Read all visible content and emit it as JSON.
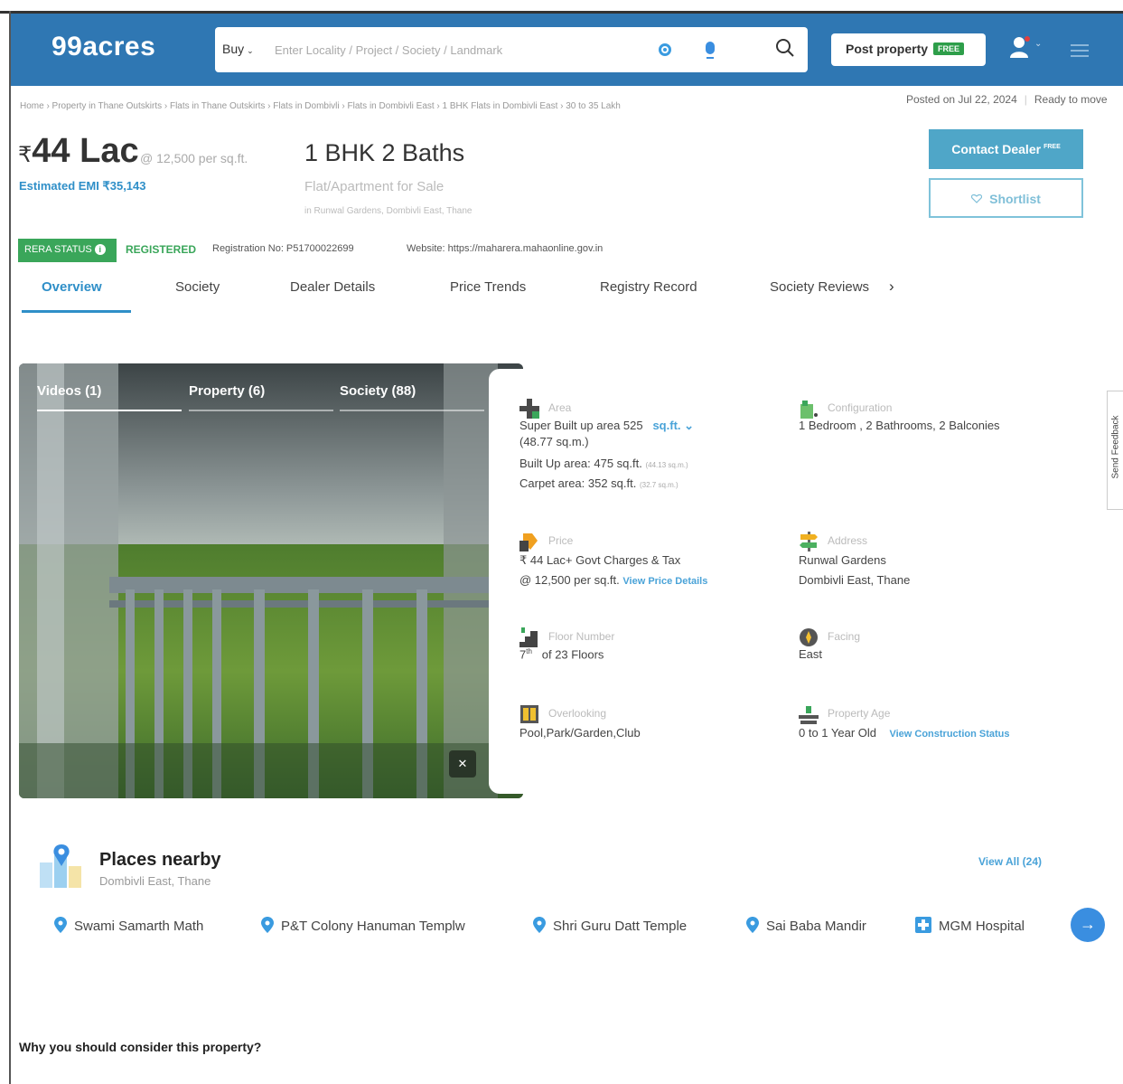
{
  "header": {
    "logo": "99acres",
    "buy_label": "Buy",
    "search_placeholder": "Enter Locality / Project / Society / Landmark",
    "post_property_label": "Post property",
    "post_property_badge": "FREE",
    "brand_color": "#2f77b3"
  },
  "breadcrumb": "Home › Property in Thane Outskirts › Flats in Thane Outskirts › Flats in Dombivli › Flats in Dombivli East › 1 BHK Flats in Dombivli East › 30 to 35 Lakh",
  "posted": {
    "date": "Posted on Jul 22, 2024",
    "status": "Ready to move"
  },
  "listing": {
    "price_symbol": "₹",
    "price": "44 Lac",
    "per_sqft": "@ 12,500 per sq.ft.",
    "emi": "Estimated EMI ₹35,143",
    "title": "1 BHK 2 Baths",
    "type": "Flat/Apartment for Sale",
    "location": "in Runwal Gardens, Dombivli East, Thane"
  },
  "actions": {
    "contact_dealer": "Contact Dealer",
    "contact_badge": "FREE",
    "shortlist": "Shortlist"
  },
  "rera": {
    "badge": "RERA STATUS",
    "status": "REGISTERED",
    "reg_no": "Registration No: P51700022699",
    "website": "Website: https://maharera.mahaonline.gov.in"
  },
  "tabs": [
    {
      "label": "Overview"
    },
    {
      "label": "Society"
    },
    {
      "label": "Dealer Details"
    },
    {
      "label": "Price Trends"
    },
    {
      "label": "Registry Record"
    },
    {
      "label": "Society Reviews"
    }
  ],
  "media": {
    "tabs": [
      {
        "label": "Videos (1)"
      },
      {
        "label": "Property (6)"
      },
      {
        "label": "Society (88)"
      }
    ]
  },
  "details": {
    "area": {
      "label": "Area",
      "super_built": "Super Built up area 525",
      "unit": "sq.ft.",
      "super_built_sqm": "(48.77 sq.m.)",
      "built_up": "Built Up area: 475 sq.ft.",
      "built_up_sqm": "(44.13 sq.m.)",
      "carpet": "Carpet area: 352 sq.ft.",
      "carpet_sqm": "(32.7 sq.m.)"
    },
    "configuration": {
      "label": "Configuration",
      "value": "1 Bedroom , 2 Bathrooms, 2 Balconies"
    },
    "price": {
      "label": "Price",
      "line1": "₹ 44 Lac+ Govt Charges & Tax",
      "line2": "@ 12,500 per sq.ft.",
      "link": "View Price Details"
    },
    "address": {
      "label": "Address",
      "line1": "Runwal Gardens",
      "line2": "Dombivli East, Thane"
    },
    "floor": {
      "label": "Floor Number",
      "floor": "7",
      "suffix": "th",
      "total": "of 23 Floors"
    },
    "facing": {
      "label": "Facing",
      "value": "East"
    },
    "overlooking": {
      "label": "Overlooking",
      "value": "Pool,Park/Garden,Club"
    },
    "age": {
      "label": "Property Age",
      "value": "0 to 1 Year Old",
      "link": "View Construction Status"
    }
  },
  "feedback_label": "Send Feedback",
  "places": {
    "title": "Places nearby",
    "subtitle": "Dombivli East, Thane",
    "view_all": "View All (24)",
    "items": [
      {
        "name": "Swami Samarth Math"
      },
      {
        "name": "P&T Colony Hanuman Templw"
      },
      {
        "name": "Shri Guru Datt Temple"
      },
      {
        "name": "Sai Baba Mandir"
      },
      {
        "name": "MGM Hospital"
      }
    ]
  },
  "consider_heading": "Why you should consider this property?"
}
